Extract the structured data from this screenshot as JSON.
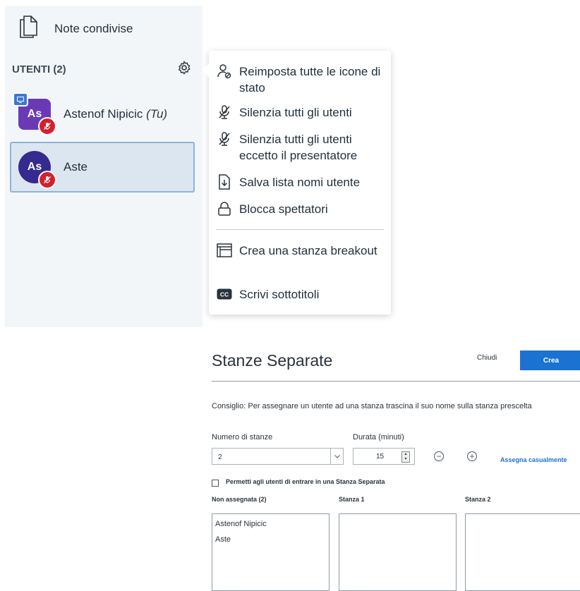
{
  "user_panel": {
    "shared_notes_label": "Note condivise",
    "users_title": "UTENTI (2)",
    "users": [
      {
        "initials": "As",
        "name": "Astenof Nipicic",
        "you_tag": "(Tu)"
      },
      {
        "initials": "As",
        "name": "Aste"
      }
    ]
  },
  "user_options_menu": {
    "items": [
      {
        "label": "Reimposta tutte le icone di stato",
        "icon": "clear-status-icon"
      },
      {
        "label": "Silenzia tutti gli utenti",
        "icon": "mute-icon"
      },
      {
        "label": "Silenzia tutti gli utenti eccetto il presentatore",
        "icon": "mute-icon"
      },
      {
        "label": "Salva lista nomi utente",
        "icon": "download-icon"
      },
      {
        "label": "Blocca spettatori",
        "icon": "lock-icon"
      },
      {
        "label": "Crea una stanza breakout",
        "icon": "rooms-icon"
      },
      {
        "label": "Scrivi sottotitoli",
        "icon": "closed-caption-icon"
      }
    ]
  },
  "breakout_dialog": {
    "title": "Stanze Separate",
    "close_label": "Chiudi",
    "create_label": "Crea",
    "hint": "Consiglio: Per assegnare un utente ad una stanza trascina il suo nome sulla stanza prescelta",
    "rooms_count_label": "Numero di stanze",
    "rooms_count_value": "2",
    "duration_label": "Durata (minuti)",
    "duration_value": "15",
    "random_assign_label": "Assegna casualmente",
    "allow_join_label": "Permetti agli utenti di entrare in una Stanza Separata",
    "allow_join_checked": false,
    "columns": [
      {
        "header": "Non assegnata (2)",
        "users": [
          "Astenof Nipicic",
          "Aste"
        ]
      },
      {
        "header": "Stanza 1",
        "users": []
      },
      {
        "header": "Stanza 2",
        "users": []
      }
    ]
  },
  "colors": {
    "primary": "#1b72d1",
    "muted_badge": "#d4202c",
    "avatar_presenter": "#6a3ab6",
    "avatar_viewer": "#352a8e"
  }
}
